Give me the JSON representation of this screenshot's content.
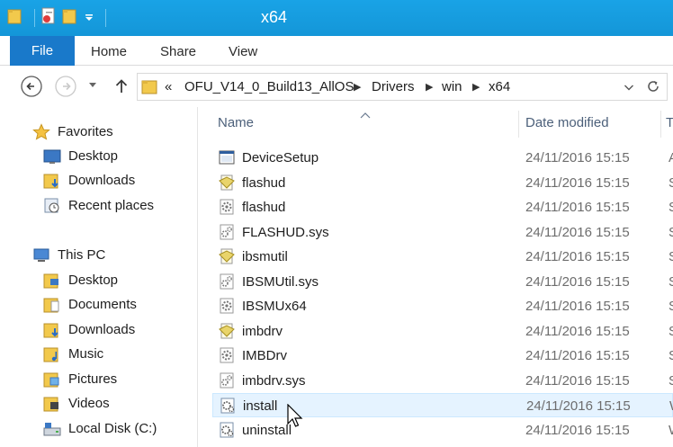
{
  "window": {
    "title": "x64",
    "accent": "#1ba1e2"
  },
  "ribbon": {
    "file_label": "File",
    "tabs": [
      {
        "label": "Home"
      },
      {
        "label": "Share"
      },
      {
        "label": "View"
      }
    ]
  },
  "address": {
    "overflow": "«",
    "crumbs": [
      "OFU_V14_0_Build13_AllOS",
      "Drivers",
      "win",
      "x64"
    ]
  },
  "nav_pane": {
    "favorites_label": "Favorites",
    "favorites": [
      {
        "label": "Desktop",
        "icon": "desktop-icon"
      },
      {
        "label": "Downloads",
        "icon": "downloads-folder-icon"
      },
      {
        "label": "Recent places",
        "icon": "recent-places-icon"
      }
    ],
    "thispc_label": "This PC",
    "thispc": [
      {
        "label": "Desktop",
        "icon": "desktop-folder-icon"
      },
      {
        "label": "Documents",
        "icon": "documents-folder-icon"
      },
      {
        "label": "Downloads",
        "icon": "downloads-folder-icon"
      },
      {
        "label": "Music",
        "icon": "music-folder-icon"
      },
      {
        "label": "Pictures",
        "icon": "pictures-folder-icon"
      },
      {
        "label": "Videos",
        "icon": "videos-folder-icon"
      },
      {
        "label": "Local Disk (C:)",
        "icon": "local-disk-icon"
      }
    ]
  },
  "file_list": {
    "columns": {
      "name": "Name",
      "date": "Date modified",
      "type": "T"
    },
    "rows": [
      {
        "name": "DeviceSetup",
        "date": "24/11/2016 15:15",
        "type": "A",
        "icon": "application-icon"
      },
      {
        "name": "flashud",
        "date": "24/11/2016 15:15",
        "type": "S",
        "icon": "security-catalog-icon"
      },
      {
        "name": "flashud",
        "date": "24/11/2016 15:15",
        "type": "S",
        "icon": "setup-info-icon"
      },
      {
        "name": "FLASHUD.sys",
        "date": "24/11/2016 15:15",
        "type": "S",
        "icon": "system-file-icon"
      },
      {
        "name": "ibsmutil",
        "date": "24/11/2016 15:15",
        "type": "S",
        "icon": "security-catalog-icon"
      },
      {
        "name": "IBSMUtil.sys",
        "date": "24/11/2016 15:15",
        "type": "S",
        "icon": "system-file-icon"
      },
      {
        "name": "IBSMUx64",
        "date": "24/11/2016 15:15",
        "type": "S",
        "icon": "setup-info-icon"
      },
      {
        "name": "imbdrv",
        "date": "24/11/2016 15:15",
        "type": "S",
        "icon": "security-catalog-icon"
      },
      {
        "name": "IMBDrv",
        "date": "24/11/2016 15:15",
        "type": "S",
        "icon": "setup-info-icon"
      },
      {
        "name": "imbdrv.sys",
        "date": "24/11/2016 15:15",
        "type": "S",
        "icon": "system-file-icon"
      },
      {
        "name": "install",
        "date": "24/11/2016 15:15",
        "type": "W",
        "icon": "script-file-icon",
        "selected": true
      },
      {
        "name": "uninstall",
        "date": "24/11/2016 15:15",
        "type": "W",
        "icon": "script-file-icon"
      }
    ]
  }
}
